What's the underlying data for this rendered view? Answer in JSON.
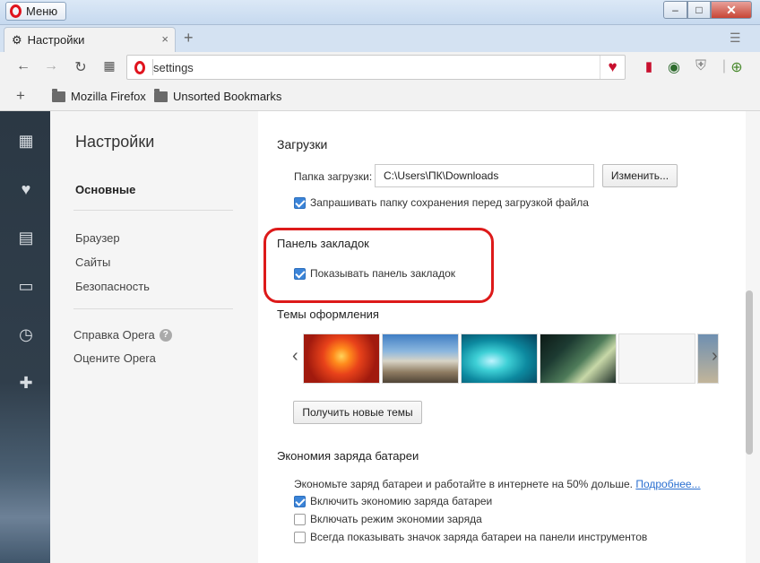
{
  "window": {
    "menu_label": "Меню",
    "minimize": "–",
    "maximize": "□",
    "close": "✕"
  },
  "tabs": [
    {
      "label": "Настройки",
      "icon": "gear-icon",
      "close": "×"
    }
  ],
  "new_tab": "+",
  "toolbar": {
    "address": "settings"
  },
  "bookmarks_bar": {
    "add": "+",
    "items": [
      {
        "label": "Mozilla Firefox",
        "icon": "folder-icon"
      },
      {
        "label": "Unsorted Bookmarks",
        "icon": "folder-icon"
      }
    ]
  },
  "nav": {
    "title": "Настройки",
    "items": [
      "Основные",
      "Браузер",
      "Сайты",
      "Безопасность"
    ],
    "help": "Справка Opera",
    "rate": "Оцените Opera"
  },
  "downloads": {
    "heading": "Загрузки",
    "folder_label": "Папка загрузки:",
    "folder_value": "C:\\Users\\ПК\\Downloads",
    "change_button": "Изменить...",
    "ask_checkbox": "Запрашивать папку сохранения перед загрузкой файла",
    "ask_checked": true
  },
  "bookmarks_panel": {
    "heading": "Панель закладок",
    "show_checkbox": "Показывать панель закладок",
    "show_checked": true
  },
  "themes": {
    "heading": "Темы оформления",
    "get_button": "Получить новые темы"
  },
  "battery": {
    "heading": "Экономия заряда батареи",
    "description": "Экономьте заряд батареи и работайте в интернете на 50% дольше.",
    "more_link": "Подробнее...",
    "options": [
      {
        "label": "Включить экономию заряда батареи",
        "checked": true
      },
      {
        "label": "Включать режим экономии заряда",
        "checked": false
      },
      {
        "label": "Всегда показывать значок заряда батареи на панели инструментов",
        "checked": false
      }
    ]
  },
  "colors": {
    "opera_red": "#e0141e",
    "highlight_red": "#dd1a1a",
    "checkbox_blue": "#3b84d8",
    "sidebar_dark": "#2b3844"
  }
}
